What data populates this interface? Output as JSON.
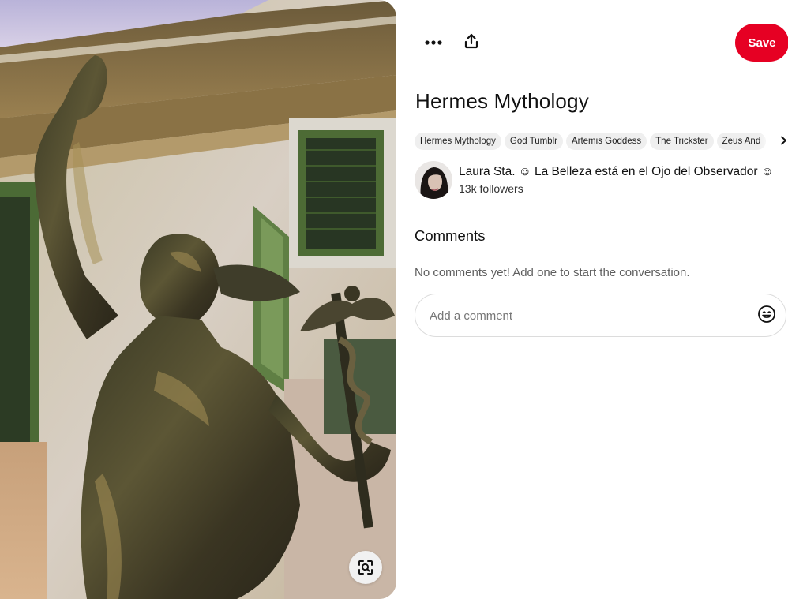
{
  "pin": {
    "image_alt": "Bronze statue of Hermes holding a caduceus in front of a building with green shutters",
    "lens_icon": "visual-search-icon"
  },
  "toolbar": {
    "more_icon": "more-icon",
    "share_icon": "share-icon",
    "save_label": "Save"
  },
  "title": "Hermes Mythology",
  "tags": [
    "Hermes Mythology",
    "God Tumblr",
    "Artemis Goddess",
    "The Trickster",
    "Zeus And"
  ],
  "creator": {
    "name": "Laura Sta. ☺ La Belleza está en el Ojo del Observador ☺",
    "followers": "13k followers"
  },
  "comments": {
    "heading": "Comments",
    "empty_text": "No comments yet! Add one to start the conversation.",
    "placeholder": "Add a comment",
    "emoji_icon": "emoji-icon"
  },
  "colors": {
    "save_button": "#e60023",
    "tag_background": "#efefef",
    "muted_text": "#5f5f5f"
  }
}
